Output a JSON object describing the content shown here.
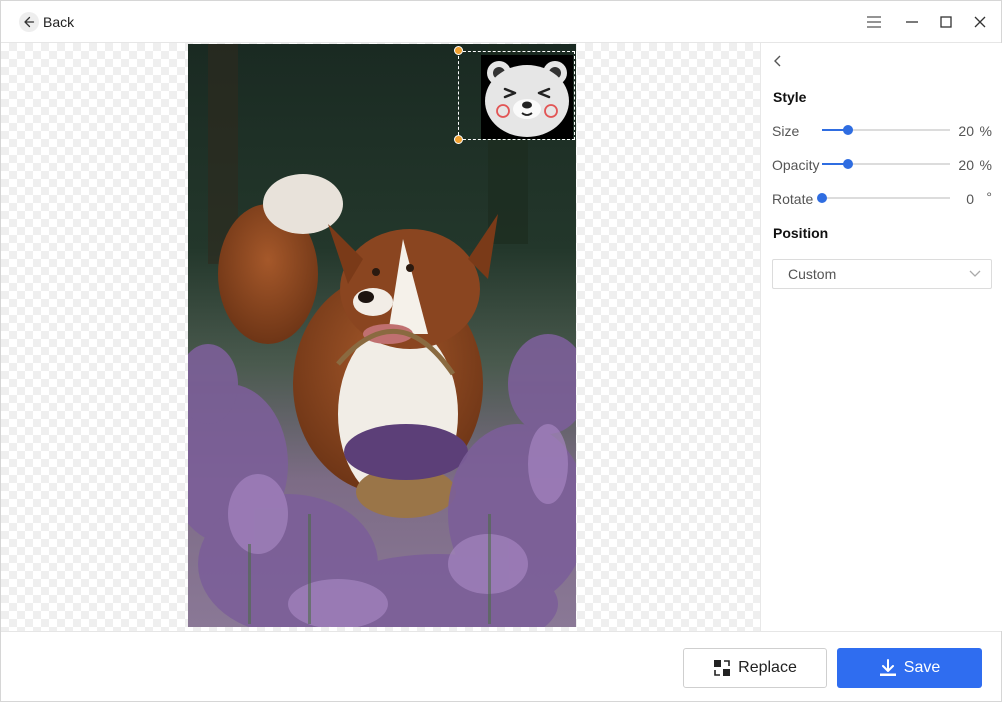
{
  "titlebar": {
    "back_label": "Back",
    "back_icon": "arrow-left-icon",
    "controls": [
      "menu-icon",
      "minimize-icon",
      "maximize-icon",
      "close-icon"
    ]
  },
  "canvas": {
    "background": "transparency-checkerboard",
    "photo_subject": "dog-in-lavender",
    "watermark_icon": "bear-face-icon",
    "selection_color": "#f0a030"
  },
  "panel": {
    "collapse_icon": "chevron-left-icon",
    "style_title": "Style",
    "sliders": [
      {
        "label": "Size",
        "value": 20,
        "unit": "%",
        "value_text": "20",
        "unit_text": "%"
      },
      {
        "label": "Opacity",
        "value": 20,
        "unit": "%",
        "value_text": "20",
        "unit_text": "%"
      },
      {
        "label": "Rotate",
        "value": 0,
        "unit": "°",
        "value_text": "0",
        "unit_text": "°"
      }
    ],
    "position_title": "Position",
    "position_select": {
      "value": "Custom",
      "icon": "chevron-down-icon"
    },
    "accent": "#2f6de1"
  },
  "footer": {
    "replace_label": "Replace",
    "replace_icon": "replace-icon",
    "save_label": "Save",
    "save_icon": "download-icon",
    "save_color": "#2f6df0"
  }
}
